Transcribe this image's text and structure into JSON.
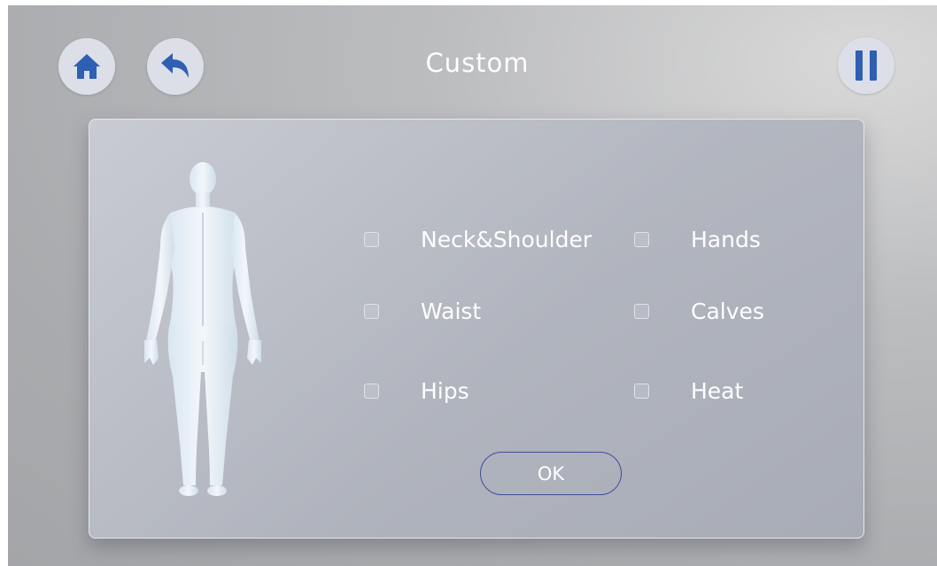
{
  "header": {
    "title": "Custom",
    "home_icon": "home-icon",
    "back_icon": "back-arrow-icon",
    "pause_icon": "pause-icon"
  },
  "panel": {
    "figure_icon": "human-body-back-view",
    "options": [
      {
        "label": "Neck&Shoulder",
        "checked": false
      },
      {
        "label": "Hands",
        "checked": false
      },
      {
        "label": "Waist",
        "checked": false
      },
      {
        "label": "Calves",
        "checked": false
      },
      {
        "label": "Hips",
        "checked": false
      },
      {
        "label": "Heat",
        "checked": false
      }
    ],
    "ok_label": "OK"
  },
  "colors": {
    "icon_blue": "#2f5fb3",
    "button_bg": "#dcdfe8",
    "ok_border": "#3e4d9e"
  }
}
